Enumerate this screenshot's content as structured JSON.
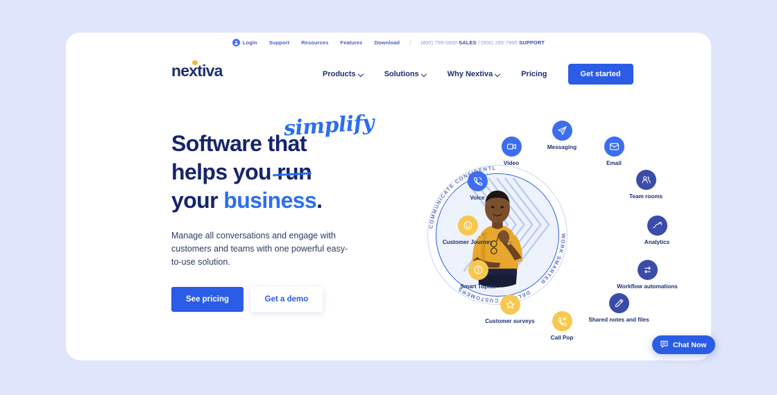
{
  "theme": {
    "page_bg": "#dfe5fb",
    "card_bg": "#ffffff",
    "brand_navy": "#1e2f70",
    "brand_blue": "#2b5ce6",
    "accent_yellow": "#f8c84e",
    "accent_indigo": "#3b4ca8",
    "logo_dot": "#f6b83c"
  },
  "utility_bar": {
    "login": "Login",
    "links": [
      "Support",
      "Resources",
      "Features",
      "Download"
    ],
    "separator": "|",
    "sales_number": "(800) 799-0600",
    "sales_label": "SALES",
    "slash": "/",
    "support_number": "(800) 285-7995",
    "support_label": "SUPPORT"
  },
  "nav": {
    "logo_text": "nextiva",
    "items": [
      {
        "label": "Products",
        "has_caret": true
      },
      {
        "label": "Solutions",
        "has_caret": true
      },
      {
        "label": "Why Nextiva",
        "has_caret": true
      },
      {
        "label": "Pricing",
        "has_caret": false
      }
    ],
    "cta": "Get started"
  },
  "hero": {
    "headline_line1": "Software that",
    "headline_line2_a": "helps you ",
    "headline_line2_struck": "run",
    "headline_script": "simplify",
    "headline_line3_a": "your ",
    "headline_line3_blue": "business",
    "headline_line3_b": ".",
    "subtext": "Manage all conversations and engage with customers and teams with one powerful easy-to-use solution.",
    "cta_primary": "See pricing",
    "cta_secondary": "Get a demo"
  },
  "circle": {
    "arc_top_left": "COMMUNICATE CONFIDENTLY",
    "arc_right": "WORK SMARTER",
    "arc_bottom": "DELIGHT CUSTOMERS"
  },
  "features": [
    {
      "id": "messaging",
      "label": "Messaging",
      "icon": "paper-plane-icon",
      "color": "blue"
    },
    {
      "id": "video",
      "label": "Video",
      "icon": "video-camera-icon",
      "color": "blue"
    },
    {
      "id": "email",
      "label": "Email",
      "icon": "envelope-icon",
      "color": "blue"
    },
    {
      "id": "voice",
      "label": "Voice",
      "icon": "phone-ring-icon",
      "color": "blue"
    },
    {
      "id": "teamrooms",
      "label": "Team rooms",
      "icon": "people-icon",
      "color": "indigo"
    },
    {
      "id": "analytics",
      "label": "Analytics",
      "icon": "trend-up-icon",
      "color": "indigo"
    },
    {
      "id": "workflow",
      "label": "Workflow automations",
      "icon": "sync-arrows-icon",
      "color": "indigo"
    },
    {
      "id": "journey",
      "label": "Customer Journey",
      "icon": "smiley-icon",
      "color": "yellow"
    },
    {
      "id": "topics",
      "label": "Smart Topics",
      "icon": "exclamation-icon",
      "color": "yellow"
    },
    {
      "id": "surveys",
      "label": "Customer surveys",
      "icon": "star-icon",
      "color": "yellow"
    },
    {
      "id": "callpop",
      "label": "Call Pop",
      "icon": "phone-incoming-icon",
      "color": "yellow"
    },
    {
      "id": "notes",
      "label": "Shared notes and files",
      "icon": "pencil-icon",
      "color": "indigo"
    }
  ],
  "chat_widget": {
    "label": "Chat Now",
    "icon": "chat-bubble-icon"
  }
}
